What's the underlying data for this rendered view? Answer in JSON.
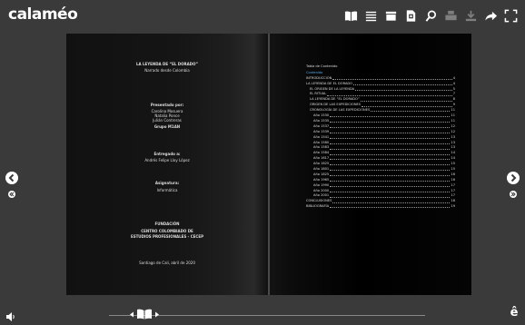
{
  "app": {
    "logo": "calaméo"
  },
  "toolbar": {
    "icons": [
      "book-icon",
      "list-icon",
      "folder-icon",
      "document-icon",
      "search-icon",
      "print-icon",
      "download-icon",
      "share-icon",
      "fullscreen-icon"
    ]
  },
  "left_page": {
    "title": "LA LEYENDA DE “EL DORADO”",
    "subtitle": "Narrado desde Colombia",
    "presented_by_label": "Presentado por:",
    "authors": [
      "Carolina Mosuera",
      "Natalia Ponce",
      "Julián Contreras"
    ],
    "group": "Grupo M1AN",
    "delivered_label": "Entregado a:",
    "teacher": "Andrés Felipe Lloy López",
    "subject_label": "Asignatura:",
    "subject": "Informática",
    "institution_label": "FUNDACIÓN",
    "institution_name": "CENTRO COLOMBIADO DE",
    "institution_name2": "ESTUDIOS PROFESIONALES - CECEP",
    "city_date": "Santiago de Cali, abril de 2020"
  },
  "right_page": {
    "toc_title": "Tabla de Contenido",
    "toc_subtitle": "Contenido",
    "entries": [
      {
        "label": "INTRODUCCIÓN",
        "page": "4",
        "level": 0
      },
      {
        "label": "LA LEYENDA DE EL DORADO",
        "page": "4",
        "level": 0
      },
      {
        "label": "EL ORIGEN DE LA LEYENDA",
        "page": "5",
        "level": 1
      },
      {
        "label": "EL RITUAL",
        "page": "7",
        "level": 1
      },
      {
        "label": "LA LEYENDA DE “EL DORADO”",
        "page": "8",
        "level": 1
      },
      {
        "label": "ORIGEN DE LAS EXPEDICIONES",
        "page": "9",
        "level": 1
      },
      {
        "label": "CRONOLOGÍA DE LAS EXPEDICIONES",
        "page": "11",
        "level": 1
      },
      {
        "label": "Año 1530",
        "page": "11",
        "level": 2
      },
      {
        "label": "Año 1535",
        "page": "11",
        "level": 2
      },
      {
        "label": "Año 1537",
        "page": "12",
        "level": 2
      },
      {
        "label": "Año 1539",
        "page": "12",
        "level": 2
      },
      {
        "label": "Año 1541",
        "page": "13",
        "level": 2
      },
      {
        "label": "Año 1580",
        "page": "13",
        "level": 2
      },
      {
        "label": "Año 1583",
        "page": "13",
        "level": 2
      },
      {
        "label": "Año 1584",
        "page": "14",
        "level": 2
      },
      {
        "label": "Año 1617",
        "page": "14",
        "level": 2
      },
      {
        "label": "Año 1625",
        "page": "15",
        "level": 2
      },
      {
        "label": "Año 1801",
        "page": "15",
        "level": 2
      },
      {
        "label": "Año 1825",
        "page": "16",
        "level": 2
      },
      {
        "label": "Año 1965",
        "page": "16",
        "level": 2
      },
      {
        "label": "Año 1990",
        "page": "17",
        "level": 2
      },
      {
        "label": "Año 2000",
        "page": "17",
        "level": 2
      },
      {
        "label": "Año 2001",
        "page": "17",
        "level": 2
      },
      {
        "label": "CONCLUSIONES",
        "page": "18",
        "level": 0
      },
      {
        "label": "BIBLIOGRAFÍA",
        "page": "19",
        "level": 0
      }
    ]
  },
  "colors": {
    "background": "#3a3a3a",
    "toc_subtitle": "#5aa7e6"
  }
}
